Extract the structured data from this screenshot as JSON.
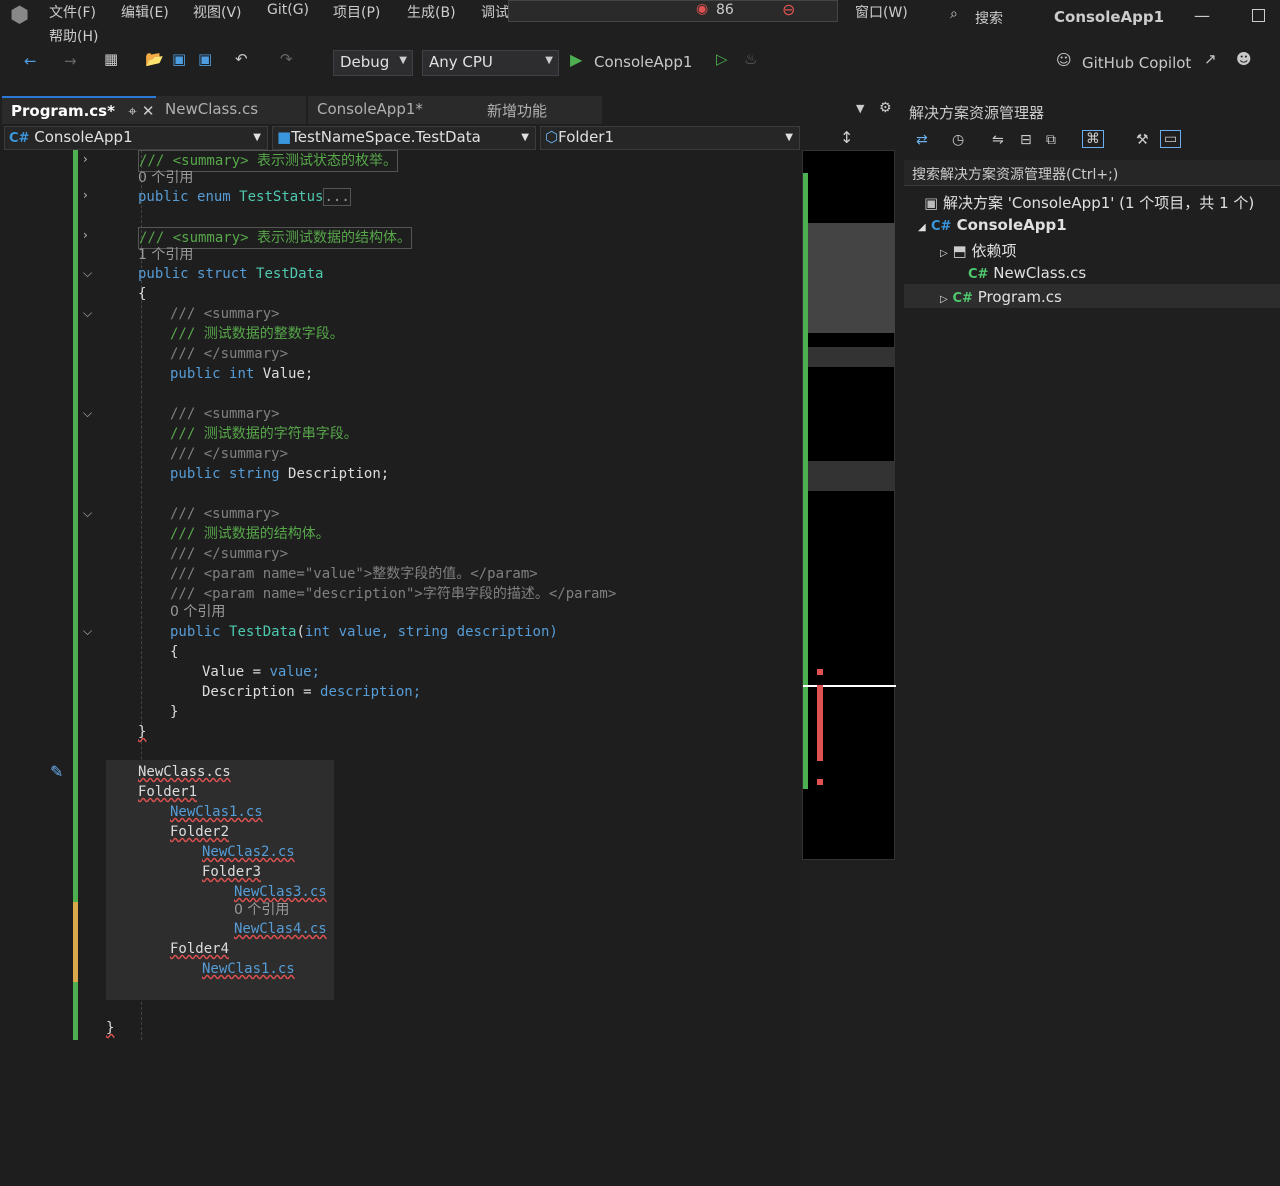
{
  "menu": {
    "items": [
      "文件(F)",
      "编辑(E)",
      "视图(V)",
      "Git(G)",
      "项目(P)",
      "生成(B)",
      "调试",
      "窗口(W)"
    ],
    "help": "帮助(H)",
    "search_label": "搜索",
    "solution_title": "ConsoleApp1",
    "badge_count": "86"
  },
  "toolbar": {
    "config": "Debug",
    "platform": "Any CPU",
    "run_target": "ConsoleApp1",
    "copilot": "GitHub Copilot"
  },
  "tabs": [
    {
      "label": "Program.cs*"
    },
    {
      "label": "NewClass.cs"
    },
    {
      "label": "ConsoleApp1*"
    },
    {
      "label": "新增功能"
    }
  ],
  "nav": {
    "project": "ConsoleApp1",
    "type": "TestNameSpace.TestData",
    "member": "Folder1"
  },
  "code": {
    "l1": "/// <summary> 表示测试状态的枚举。",
    "r1": "0 个引用",
    "l2a": "public",
    "l2b": "enum",
    "l2c": "TestStatus",
    "l2d": "...",
    "l3": "/// <summary> 表示测试数据的结构体。",
    "r3": "1 个引用",
    "l4a": "public",
    "l4b": "struct",
    "l4c": "TestData",
    "brace_open": "{",
    "s1": "/// <summary>",
    "c1": "/// 测试数据的整数字段。",
    "e1": "/// </summary>",
    "f1a": "public",
    "f1b": "int",
    "f1c": "Value;",
    "s2": "/// <summary>",
    "c2": "/// 测试数据的字符串字段。",
    "e2": "/// </summary>",
    "f2a": "public",
    "f2b": "string",
    "f2c": "Description;",
    "s3": "/// <summary>",
    "c3": "/// 测试数据的结构体。",
    "e3": "/// </summary>",
    "p1": "/// <param name=\"value\">整数字段的值。</param>",
    "p2": "/// <param name=\"description\">字符串字段的描述。</param>",
    "r4": "0 个引用",
    "ctor_a": "public",
    "ctor_b": "TestData",
    "ctor_c": "(",
    "ctor_d": "int",
    "ctor_e": "value,",
    "ctor_f": "string",
    "ctor_g": "description)",
    "b2": "{",
    "a1": "Value = ",
    "a1v": "value;",
    "a2": "Description = ",
    "a2v": "description;",
    "b3": "}",
    "b4": "}",
    "t1": "NewClass.cs",
    "t2": "Folder1",
    "t3": "NewClas1.cs",
    "t4": "Folder2",
    "t5": "NewClas2.cs",
    "t6": "Folder3",
    "t7": "NewClas3.cs",
    "r5": "0 个引用",
    "t8": "NewClas4.cs",
    "t9": "Folder4",
    "t10": "NewClas1.cs",
    "b5": "}"
  },
  "solution_explorer": {
    "title": "解决方案资源管理器",
    "search": "搜索解决方案资源管理器(Ctrl+;)",
    "solution": "解决方案 'ConsoleApp1' (1 个项目，共 1 个)",
    "project": "ConsoleApp1",
    "deps": "依赖项",
    "file1": "NewClass.cs",
    "file2": "Program.cs"
  },
  "colors": {
    "accent": "#2b79d7",
    "changed_bar": "#4caf50",
    "error": "#e05252"
  }
}
